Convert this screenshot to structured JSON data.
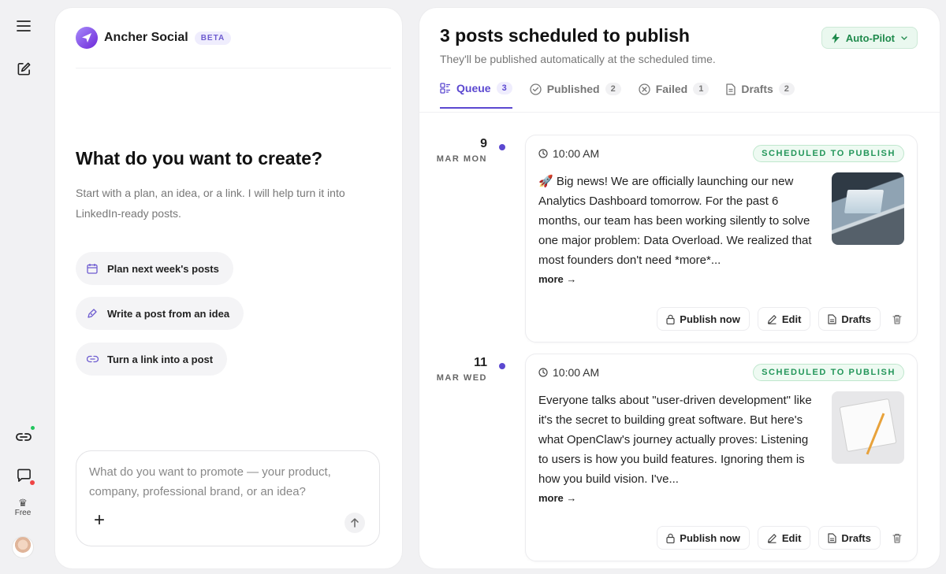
{
  "rail": {
    "plan_label": "Free"
  },
  "brand": {
    "name": "Ancher Social",
    "badge": "BETA"
  },
  "create": {
    "title": "What do you want to create?",
    "subtitle": "Start with a plan, an idea, or a link. I will help turn it into LinkedIn-ready posts.",
    "suggestions": [
      {
        "label": "Plan next week's posts",
        "icon": "calendar-icon"
      },
      {
        "label": "Write a post from an idea",
        "icon": "pen-icon"
      },
      {
        "label": "Turn a link into a post",
        "icon": "link-icon"
      }
    ],
    "composer_placeholder": "What do you want to promote — your product, company, professional brand, or an idea?"
  },
  "schedule": {
    "title": "3 posts scheduled to publish",
    "subtitle": "They'll be published automatically at the scheduled time.",
    "autopilot_label": "Auto-Pilot",
    "tabs": [
      {
        "label": "Queue",
        "count": "3",
        "icon": "list-icon",
        "active": true
      },
      {
        "label": "Published",
        "count": "2",
        "icon": "check-circle-icon"
      },
      {
        "label": "Failed",
        "count": "1",
        "icon": "x-circle-icon"
      },
      {
        "label": "Drafts",
        "count": "2",
        "icon": "document-icon"
      }
    ],
    "posts": [
      {
        "day": "9",
        "month_weekday": "MAR MON",
        "time": "10:00 AM",
        "status": "SCHEDULED TO PUBLISH",
        "text": "🚀 Big news! We are officially launching our new Analytics Dashboard tomorrow. For the past 6 months, our team has been working silently to solve one major problem: Data Overload. We realized that most founders don't need *more*...",
        "more_label": "more →",
        "image": "laptop-dashboard-photo",
        "actions": {
          "publish": "Publish now",
          "edit": "Edit",
          "drafts": "Drafts"
        }
      },
      {
        "day": "11",
        "month_weekday": "MAR WED",
        "time": "10:00 AM",
        "status": "SCHEDULED TO PUBLISH",
        "text": "Everyone talks about \"user-driven development\" like it's the secret to building great software. But here's what OpenClaw's journey actually proves: Listening to users is how you build features. Ignoring them is how you build vision. I've...",
        "more_label": "more →",
        "image": "notebook-pencil-photo",
        "actions": {
          "publish": "Publish now",
          "edit": "Edit",
          "drafts": "Drafts"
        }
      }
    ]
  },
  "colors": {
    "accent": "#5b48d0",
    "status_green": "#23965a"
  }
}
